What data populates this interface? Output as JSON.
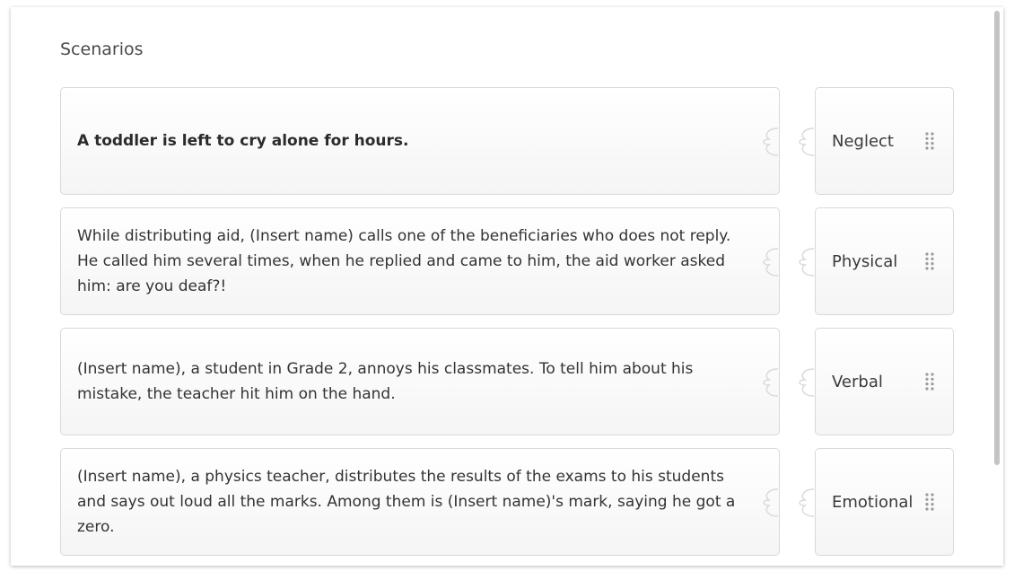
{
  "heading": "Scenarios",
  "rows": [
    {
      "scenario": "A toddler is left to cry alone for hours.",
      "answer": "Neglect"
    },
    {
      "scenario": "While distributing aid, (Insert name) calls one of the beneficiaries who does not reply. He called him several times, when he replied and came to him, the aid worker asked him: are you deaf?!",
      "answer": "Physical"
    },
    {
      "scenario": "(Insert name), a student in Grade 2, annoys his classmates. To tell him about his mistake, the teacher hit him on the hand.",
      "answer": "Verbal"
    },
    {
      "scenario": "(Insert name), a physics teacher, distributes the results of the exams to his students and says out loud all the marks. Among them is (Insert name)'s mark, saying he got a zero.",
      "answer": "Emotional"
    }
  ],
  "icons": {
    "drag_handle": "drag-grip-icon",
    "socket": "puzzle-socket-icon",
    "tab": "puzzle-tab-icon"
  },
  "colors": {
    "border": "#d9d9d9",
    "text": "#333333",
    "heading": "#4a4a4a"
  }
}
